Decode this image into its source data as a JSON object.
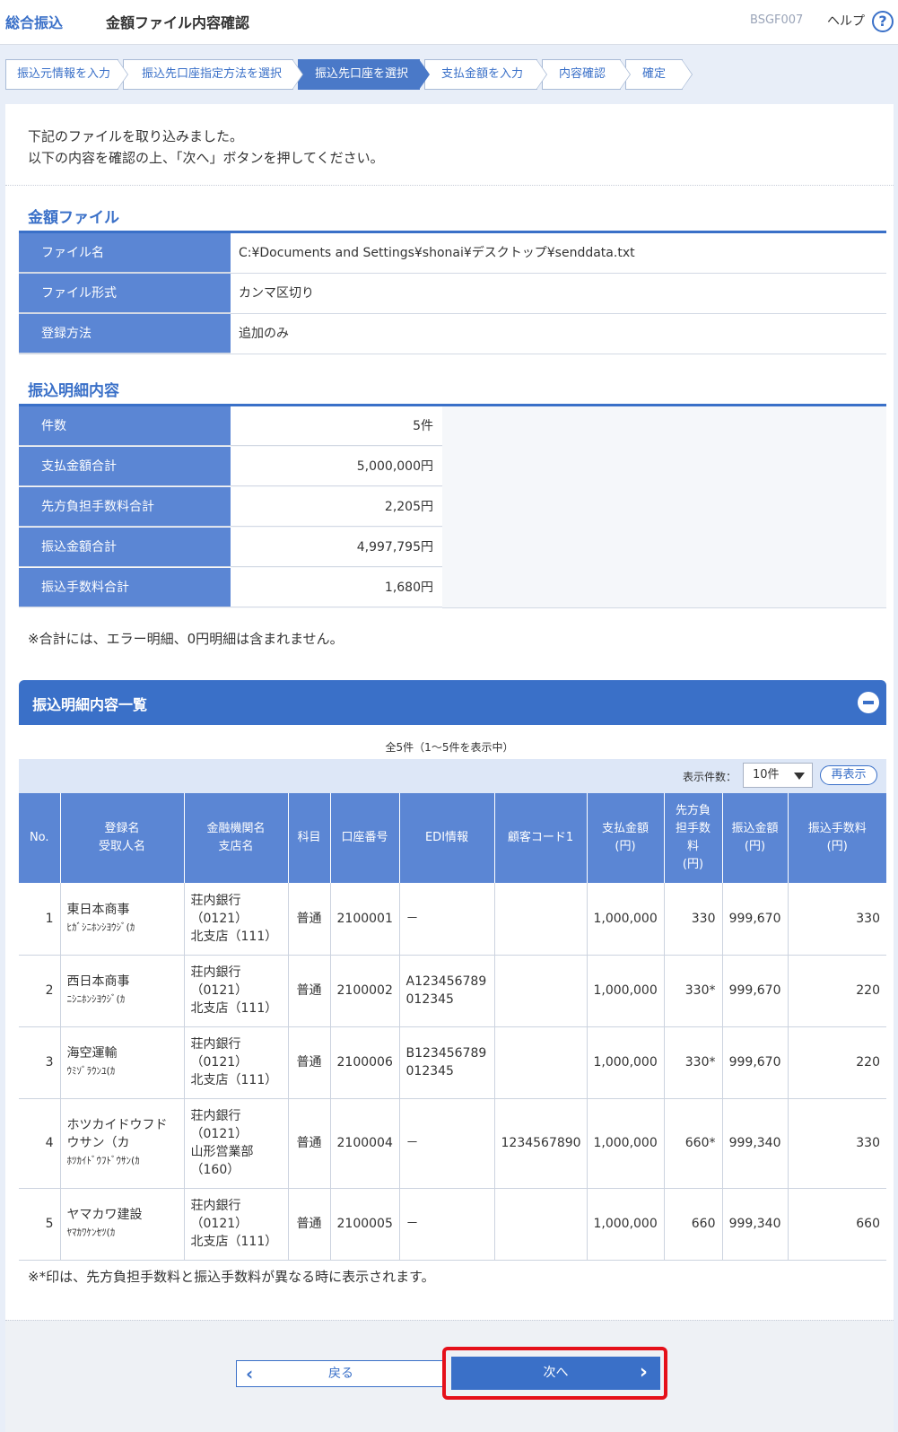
{
  "header": {
    "app": "総合振込",
    "title": "金額ファイル内容確認",
    "code": "BSGF007",
    "help": "ヘルプ",
    "help_icon": "?"
  },
  "steps": [
    "振込元情報を入力",
    "振込先口座指定方法を選択",
    "振込先口座を選択",
    "支払金額を入力",
    "内容確認",
    "確定"
  ],
  "intro": {
    "line1": "下記のファイルを取り込みました。",
    "line2": "以下の内容を確認の上、「次へ」ボタンを押してください。"
  },
  "amount_file": {
    "title": "金額ファイル",
    "rows": [
      {
        "label": "ファイル名",
        "value": "C:¥Documents and Settings¥shonai¥デスクトップ¥senddata.txt"
      },
      {
        "label": "ファイル形式",
        "value": "カンマ区切り"
      },
      {
        "label": "登録方法",
        "value": "追加のみ"
      }
    ]
  },
  "summary": {
    "title": "振込明細内容",
    "rows": [
      {
        "label": "件数",
        "value": "5件"
      },
      {
        "label": "支払金額合計",
        "value": "5,000,000円"
      },
      {
        "label": "先方負担手数料合計",
        "value": "2,205円"
      },
      {
        "label": "振込金額合計",
        "value": "4,997,795円"
      },
      {
        "label": "振込手数料合計",
        "value": "1,680円"
      }
    ],
    "note": "※合計には、エラー明細、0円明細は含まれません。"
  },
  "list": {
    "title": "振込明細内容一覧",
    "count_text": "全5件（1～5件を表示中）",
    "display_label": "表示件数：",
    "display_value": "10件",
    "refresh": "再表示",
    "columns": [
      {
        "l1": "No.",
        "l2": "",
        "l3": "",
        "l4": ""
      },
      {
        "l1": "登録名",
        "l2": "受取人名",
        "l3": "",
        "l4": ""
      },
      {
        "l1": "金融機関名",
        "l2": "支店名",
        "l3": "",
        "l4": ""
      },
      {
        "l1": "科目",
        "l2": "",
        "l3": "",
        "l4": ""
      },
      {
        "l1": "口座番号",
        "l2": "",
        "l3": "",
        "l4": ""
      },
      {
        "l1": "EDI情報",
        "l2": "",
        "l3": "",
        "l4": ""
      },
      {
        "l1": "顧客コード1",
        "l2": "",
        "l3": "",
        "l4": ""
      },
      {
        "l1": "支払金額",
        "l2": "(円)",
        "l3": "",
        "l4": ""
      },
      {
        "l1": "先方負",
        "l2": "担手数",
        "l3": "料",
        "l4": "(円)"
      },
      {
        "l1": "振込金額",
        "l2": "(円)",
        "l3": "",
        "l4": ""
      },
      {
        "l1": "振込手数料",
        "l2": "(円)",
        "l3": "",
        "l4": ""
      }
    ],
    "rows": [
      {
        "no": "1",
        "name": "東日本商事",
        "kana": "ﾋｶﾞｼﾆﾎﾝｼﾖｳｼﾞ(ｶ",
        "bank": "荘内銀行",
        "bank_code": "（0121）",
        "branch": "北支店（111）",
        "branch2": "",
        "type": "普通",
        "account": "2100001",
        "edi1": "－",
        "edi2": "",
        "cust": "",
        "pay": "1,000,000",
        "fee_b": "330",
        "amount": "999,670",
        "fee": "330"
      },
      {
        "no": "2",
        "name": "西日本商事",
        "kana": "ﾆｼﾆﾎﾝｼﾖｳｼﾞ(ｶ",
        "bank": "荘内銀行",
        "bank_code": "（0121）",
        "branch": "北支店（111）",
        "branch2": "",
        "type": "普通",
        "account": "2100002",
        "edi1": "A123456789",
        "edi2": "012345",
        "cust": "",
        "pay": "1,000,000",
        "fee_b": "330*",
        "amount": "999,670",
        "fee": "220"
      },
      {
        "no": "3",
        "name": "海空運輸",
        "kana": "ｳﾐｿﾞﾗｳﾝﾕ(ｶ",
        "bank": "荘内銀行",
        "bank_code": "（0121）",
        "branch": "北支店（111）",
        "branch2": "",
        "type": "普通",
        "account": "2100006",
        "edi1": "B123456789",
        "edi2": "012345",
        "cust": "",
        "pay": "1,000,000",
        "fee_b": "330*",
        "amount": "999,670",
        "fee": "220"
      },
      {
        "no": "4",
        "name": "ホツカイドウフドウサン（カ",
        "kana": "ﾎﾂｶｲﾄﾞｳﾌﾄﾞｳｻﾝ(ｶ",
        "bank": "荘内銀行",
        "bank_code": "（0121）",
        "branch": "山形営業部",
        "branch2": "（160）",
        "type": "普通",
        "account": "2100004",
        "edi1": "－",
        "edi2": "",
        "cust": "1234567890",
        "pay": "1,000,000",
        "fee_b": "660*",
        "amount": "999,340",
        "fee": "330"
      },
      {
        "no": "5",
        "name": "ヤマカワ建設",
        "kana": "ﾔﾏｶﾜｹﾝｾﾂ(ｶ",
        "bank": "荘内銀行",
        "bank_code": "（0121）",
        "branch": "北支店（111）",
        "branch2": "",
        "type": "普通",
        "account": "2100005",
        "edi1": "－",
        "edi2": "",
        "cust": "",
        "pay": "1,000,000",
        "fee_b": "660",
        "amount": "999,340",
        "fee": "660"
      }
    ],
    "note": "※*印は、先方負担手数料と振込手数料が異なる時に表示されます。"
  },
  "footer": {
    "back": "戻る",
    "next": "次へ",
    "back_icon": "chevron-left",
    "next_icon": "chevron-right"
  },
  "colors": {
    "accent": "#3a70c8",
    "header_cell": "#5b86d4",
    "highlight": "#e5101a"
  }
}
